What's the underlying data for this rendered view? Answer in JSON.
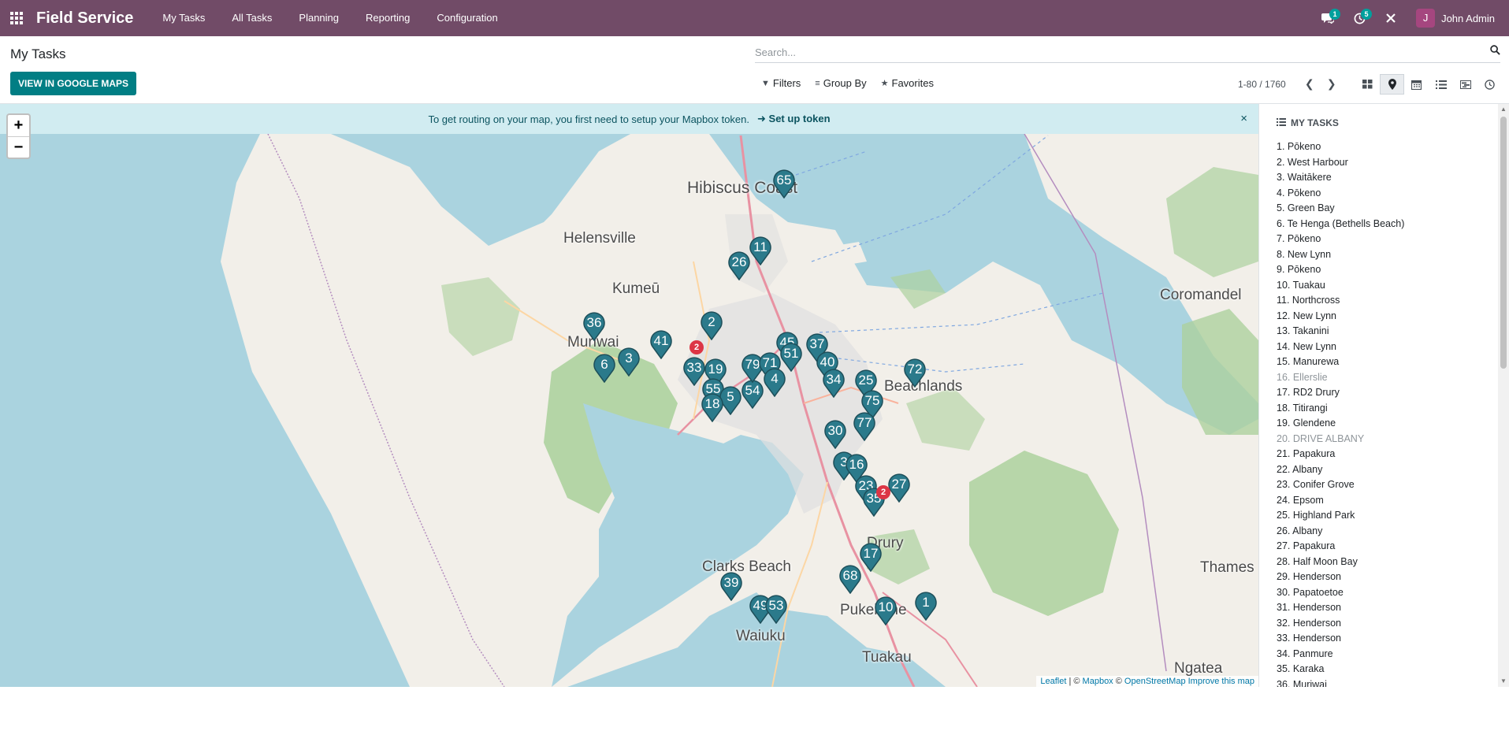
{
  "navbar": {
    "app_name": "Field Service",
    "menu": [
      "My Tasks",
      "All Tasks",
      "Planning",
      "Reporting",
      "Configuration"
    ],
    "messages_badge": "1",
    "activities_badge": "5",
    "user_initial": "J",
    "user_name": "John Admin"
  },
  "control_panel": {
    "title": "My Tasks",
    "google_maps_button": "VIEW IN GOOGLE MAPS",
    "search_placeholder": "Search...",
    "filters_label": "Filters",
    "groupby_label": "Group By",
    "favorites_label": "Favorites",
    "pager_value": "1-80 / 1760",
    "views": [
      "kanban",
      "map",
      "calendar",
      "list",
      "gantt",
      "activity"
    ],
    "active_view": "map"
  },
  "map": {
    "zoom_in": "+",
    "zoom_out": "−",
    "banner_text": "To get routing on your map, you first need to setup your Mapbox token.",
    "banner_link": "Set up token",
    "banner_close": "×",
    "places": [
      "Hibiscus Coast",
      "Helensville",
      "Kumeū",
      "Muriwai",
      "Beachlands",
      "Drury",
      "Clarks Beach",
      "Pukekohe",
      "Waiuku",
      "Tuakau",
      "Thames",
      "Coromandel",
      "Ngatea"
    ],
    "pins": [
      "65",
      "11",
      "26",
      "2",
      "36",
      "41",
      "3",
      "6",
      "19",
      "55",
      "5",
      "18",
      "54",
      "45",
      "37",
      "51",
      "40",
      "34",
      "25",
      "72",
      "75",
      "77",
      "30",
      "3",
      "16",
      "23",
      "27",
      "35",
      "17",
      "68",
      "39",
      "49",
      "53",
      "10",
      "1",
      "33",
      "79",
      "71",
      "4"
    ],
    "clusters": [
      "2",
      "2"
    ],
    "pin_color": "#2b7a8b",
    "attribution_leaflet": "Leaflet",
    "attribution_sep1": " | © ",
    "attribution_mapbox": "Mapbox",
    "attribution_sep2": " © ",
    "attribution_osm": "OpenStreetMap",
    "attribution_improve": "Improve this map"
  },
  "task_panel": {
    "title": "MY TASKS",
    "items": [
      "1. Pōkeno",
      "2. West Harbour",
      "3. Waitākere",
      "4. Pōkeno",
      "5. Green Bay",
      "6. Te Henga (Bethells Beach)",
      "7. Pōkeno",
      "8. New Lynn",
      "9. Pōkeno",
      "10. Tuakau",
      "11. Northcross",
      "12. New Lynn",
      "13. Takanini",
      "14. New Lynn",
      "15. Manurewa",
      "16. Ellerslie",
      "17. RD2 Drury",
      "18. Titirangi",
      "19. Glendene",
      "20. DRIVE ALBANY",
      "21. Papakura",
      "22. Albany",
      "23. Conifer Grove",
      "24. Epsom",
      "25. Highland Park",
      "26. Albany",
      "27. Papakura",
      "28. Half Moon Bay",
      "29. Henderson",
      "30. Papatoetoe",
      "31. Henderson",
      "32. Henderson",
      "33. Henderson",
      "34. Panmure",
      "35. Karaka",
      "36. Muriwai"
    ]
  },
  "colors": {
    "navbar": "#714b67",
    "primary_button": "#017e84",
    "banner_bg": "#d1ecf1",
    "water": "#aad3df",
    "land": "#f2efe9"
  }
}
